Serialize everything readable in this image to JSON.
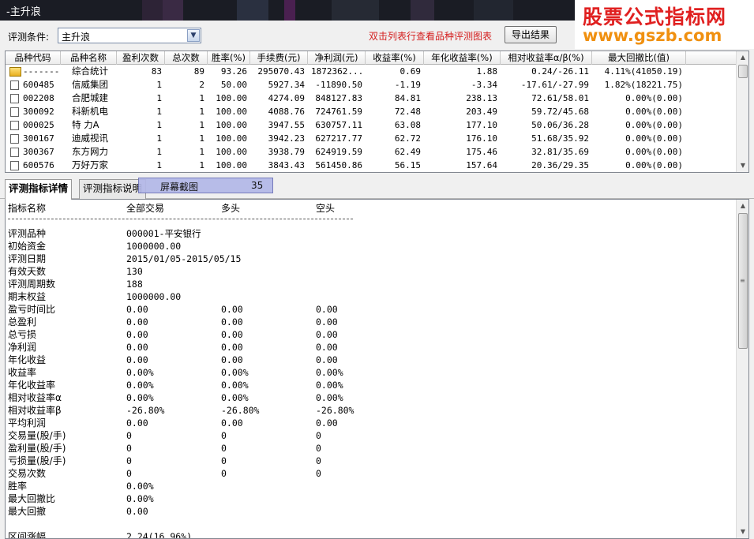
{
  "window": {
    "title": "-主升浪"
  },
  "watermark": {
    "line1": "股票公式指标网",
    "line2": "www.gszb.com"
  },
  "condition": {
    "label": "评测条件:",
    "selected": "主升浪",
    "hint": "双击列表行查看品种评测图表",
    "export_label": "导出结果"
  },
  "grid": {
    "columns": [
      "品种代码",
      "品种名称",
      "盈利次数",
      "总次数",
      "胜率(%)",
      "手续费(元)",
      "净利润(元)",
      "收益率(%)",
      "年化收益率(%)",
      "相对收益率α/β(%)",
      "最大回撤比(值)"
    ],
    "rows": [
      [
        "-------",
        "综合统计",
        "83",
        "89",
        "93.26",
        "295070.43",
        "1872362...",
        "0.69",
        "1.88",
        "0.24/-26.11",
        "4.11%(41050.19)"
      ],
      [
        "600485",
        "信威集团",
        "1",
        "2",
        "50.00",
        "5927.34",
        "-11890.50",
        "-1.19",
        "-3.34",
        "-17.61/-27.99",
        "1.82%(18221.75)"
      ],
      [
        "002208",
        "合肥城建",
        "1",
        "1",
        "100.00",
        "4274.09",
        "848127.83",
        "84.81",
        "238.13",
        "72.61/58.01",
        "0.00%(0.00)"
      ],
      [
        "300092",
        "科新机电",
        "1",
        "1",
        "100.00",
        "4088.76",
        "724761.59",
        "72.48",
        "203.49",
        "59.72/45.68",
        "0.00%(0.00)"
      ],
      [
        "000025",
        "特 力A",
        "1",
        "1",
        "100.00",
        "3947.55",
        "630757.11",
        "63.08",
        "177.10",
        "50.06/36.28",
        "0.00%(0.00)"
      ],
      [
        "300167",
        "迪威视讯",
        "1",
        "1",
        "100.00",
        "3942.23",
        "627217.77",
        "62.72",
        "176.10",
        "51.68/35.92",
        "0.00%(0.00)"
      ],
      [
        "300367",
        "东方网力",
        "1",
        "1",
        "100.00",
        "3938.79",
        "624919.59",
        "62.49",
        "175.46",
        "32.81/35.69",
        "0.00%(0.00)"
      ],
      [
        "600576",
        "万好万家",
        "1",
        "1",
        "100.00",
        "3843.43",
        "561450.86",
        "56.15",
        "157.64",
        "20.36/29.35",
        "0.00%(0.00)"
      ]
    ]
  },
  "tabs": [
    {
      "label": "评测指标详情",
      "active": true
    },
    {
      "label": "评测指标说明",
      "active": false
    }
  ],
  "overlay": {
    "label": "屏幕截图",
    "number": "35"
  },
  "detail": {
    "headers": [
      "指标名称",
      "全部交易",
      "多头",
      "空头"
    ],
    "separator": "--------------------------------------------------------------------------------",
    "rows": [
      [
        "评测品种",
        "000001-平安银行",
        "",
        ""
      ],
      [
        "初始资金",
        "1000000.00",
        "",
        ""
      ],
      [
        "评测日期",
        "2015/01/05-2015/05/15",
        "",
        ""
      ],
      [
        "有效天数",
        "130",
        "",
        ""
      ],
      [
        "评测周期数",
        "188",
        "",
        ""
      ],
      [
        "期末权益",
        "1000000.00",
        "",
        ""
      ],
      [
        "盈亏时间比",
        "0.00",
        "0.00",
        "0.00"
      ],
      [
        "总盈利",
        "0.00",
        "0.00",
        "0.00"
      ],
      [
        "总亏损",
        "0.00",
        "0.00",
        "0.00"
      ],
      [
        "净利润",
        "0.00",
        "0.00",
        "0.00"
      ],
      [
        "年化收益",
        "0.00",
        "0.00",
        "0.00"
      ],
      [
        "收益率",
        "0.00%",
        "0.00%",
        "0.00%"
      ],
      [
        "年化收益率",
        "0.00%",
        "0.00%",
        "0.00%"
      ],
      [
        "相对收益率α",
        "0.00%",
        " 0.00%",
        " 0.00%"
      ],
      [
        "相对收益率β",
        "-26.80%",
        " -26.80%",
        " -26.80%"
      ],
      [
        "平均利润",
        "0.00",
        "0.00",
        "0.00"
      ],
      [
        "交易量(股/手)",
        "0",
        "0",
        "0"
      ],
      [
        "盈利量(股/手)",
        "0",
        "0",
        "0"
      ],
      [
        "亏损量(股/手)",
        "0",
        "0",
        "0"
      ],
      [
        "交易次数",
        "0",
        "0",
        "0"
      ],
      [
        "胜率",
        "0.00%",
        "",
        ""
      ],
      [
        "最大回撤比",
        "0.00%",
        "",
        ""
      ],
      [
        "最大回撤",
        "0.00",
        "",
        ""
      ],
      [
        "",
        "",
        "",
        ""
      ],
      [
        "区间涨幅",
        "2.24(16.96%)",
        "",
        ""
      ]
    ]
  }
}
